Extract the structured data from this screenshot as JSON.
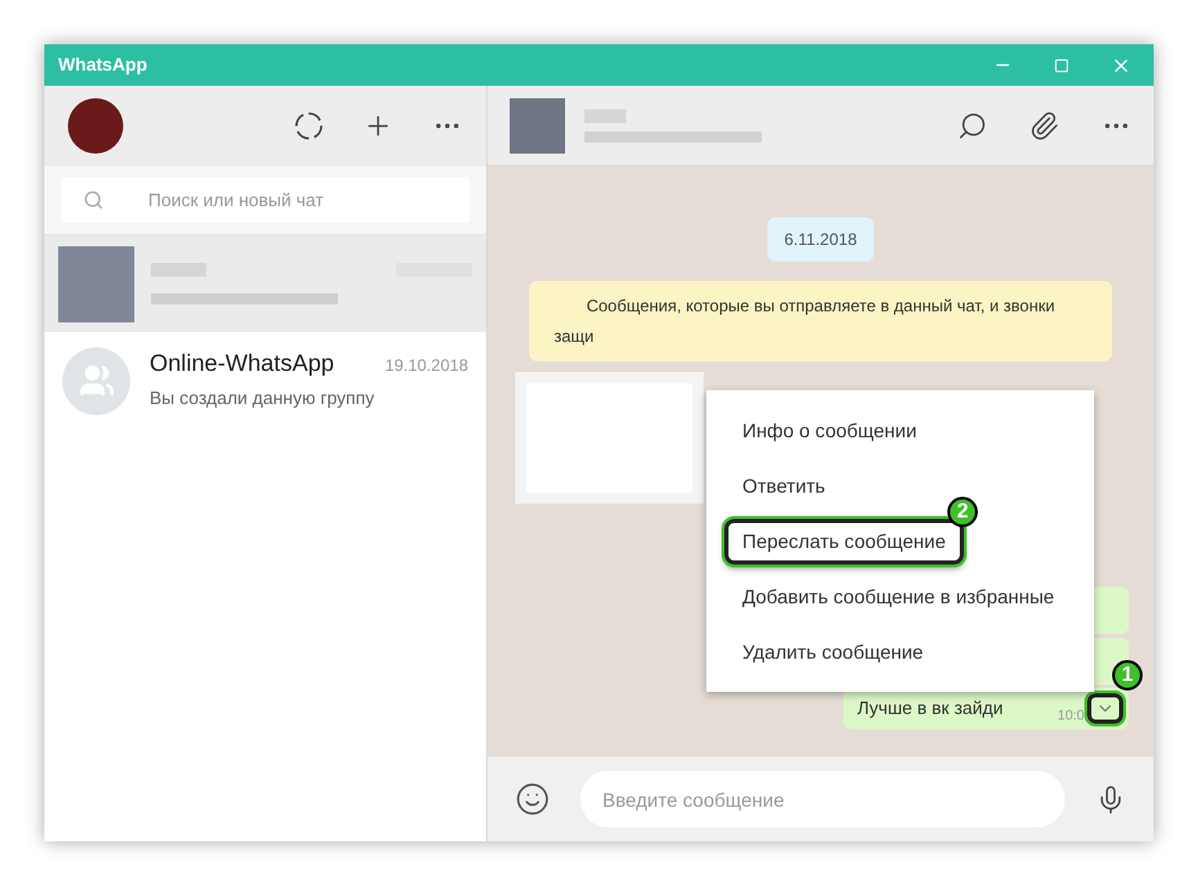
{
  "window": {
    "title": "WhatsApp"
  },
  "sidebar": {
    "search": {
      "placeholder": "Поиск или новый чат"
    },
    "chats": [
      {
        "kind": "blurred",
        "selected": true
      },
      {
        "kind": "group",
        "name": "Online-WhatsApp",
        "date": "19.10.2018",
        "preview": "Вы создали данную группу",
        "selected": false
      }
    ]
  },
  "chat": {
    "date": "6.11.2018",
    "notice": "Сообщения, которые вы отправляете в данный чат, и звонки",
    "notice_line2": "защи",
    "last_message": {
      "text": "Лучше в вк зайди",
      "time": "10:0"
    },
    "composer": {
      "placeholder": "Введите сообщение"
    }
  },
  "context_menu": [
    {
      "label": "Инфо о сообщении",
      "highlighted": false
    },
    {
      "label": "Ответить",
      "highlighted": false
    },
    {
      "label": "Переслать сообщение",
      "highlighted": true,
      "badge": "2"
    },
    {
      "label": "Добавить сообщение в избранные",
      "highlighted": false
    },
    {
      "label": "Удалить сообщение",
      "highlighted": false
    }
  ],
  "menu_button_badge": "1"
}
